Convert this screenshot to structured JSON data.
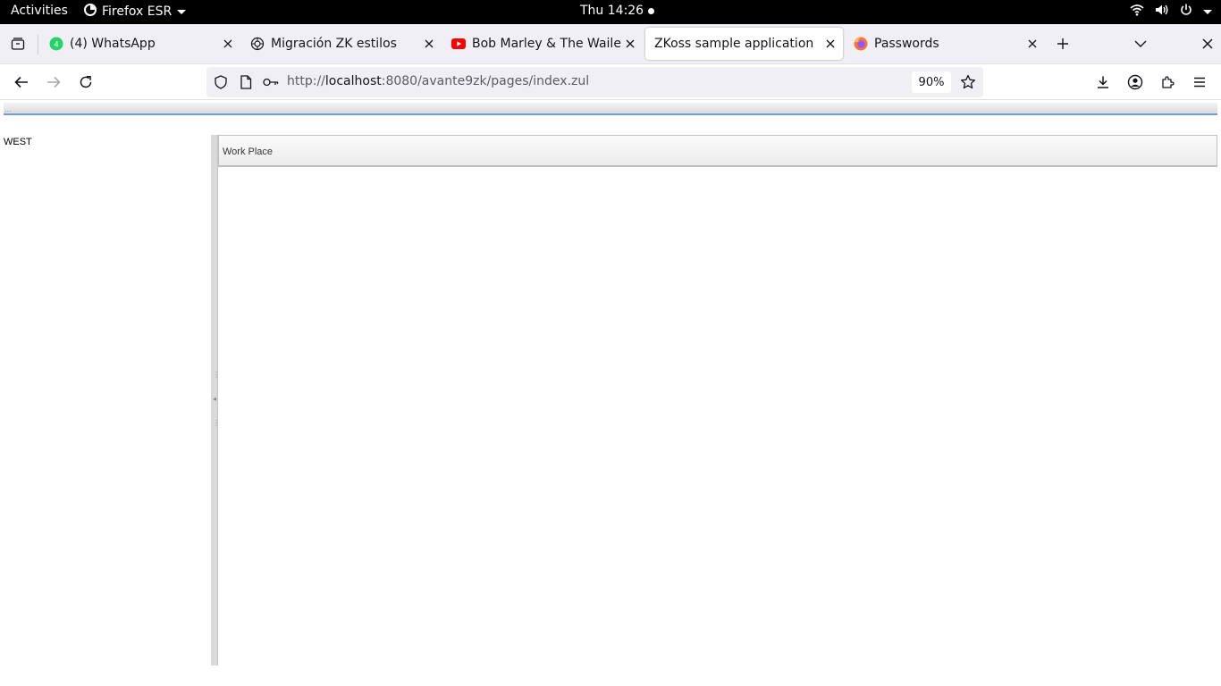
{
  "topbar": {
    "activities": "Activities",
    "app_name": "Firefox ESR",
    "clock": "Thu 14:26"
  },
  "tabs": [
    {
      "title": "(4) WhatsApp",
      "icon": "whatsapp-icon",
      "badge": "4",
      "active": false
    },
    {
      "title": "Migración ZK estilos",
      "icon": "openai-icon",
      "active": false
    },
    {
      "title": "Bob Marley & The Wailers",
      "icon": "youtube-icon",
      "active": false
    },
    {
      "title": "ZKoss sample application",
      "icon": "",
      "active": true
    },
    {
      "title": "Passwords",
      "icon": "firefox-icon",
      "active": false
    }
  ],
  "navbar": {
    "url_prefix": "http://",
    "url_host": "localhost",
    "url_rest": ":8080/avante9zk/pages/index.zul",
    "zoom": "90%"
  },
  "page": {
    "north_dots": "...",
    "west_label": "WEST",
    "center_title": "Work Place"
  },
  "colors": {
    "whatsapp": "#25d366",
    "youtube": "#ff0000",
    "zk_accent": "#6f9dd4"
  }
}
